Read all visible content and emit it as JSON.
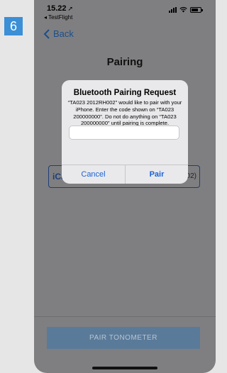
{
  "step": {
    "number": "6"
  },
  "status_bar": {
    "time": "15.22",
    "back_app": "◂ TestFlight"
  },
  "nav": {
    "back_label": "Back"
  },
  "page": {
    "title": "Pairing"
  },
  "device": {
    "left_text": "iCa",
    "right_text": "02)"
  },
  "dialog": {
    "title": "Bluetooth Pairing Request",
    "message": "“TA023 2012RH002” would like to pair with your iPhone. Enter the code shown on “TA023 200000000”. Do not do anything on “TA023 200000000” until pairing is complete.",
    "input_value": "",
    "cancel_label": "Cancel",
    "pair_label": "Pair"
  },
  "footer": {
    "pair_button_label": "PAIR TONOMETER"
  },
  "colors": {
    "badge": "#3a8fd6",
    "link": "#1c4e8a",
    "dialog_button": "#1a62d6",
    "disabled_button": "#5a7a9a"
  }
}
